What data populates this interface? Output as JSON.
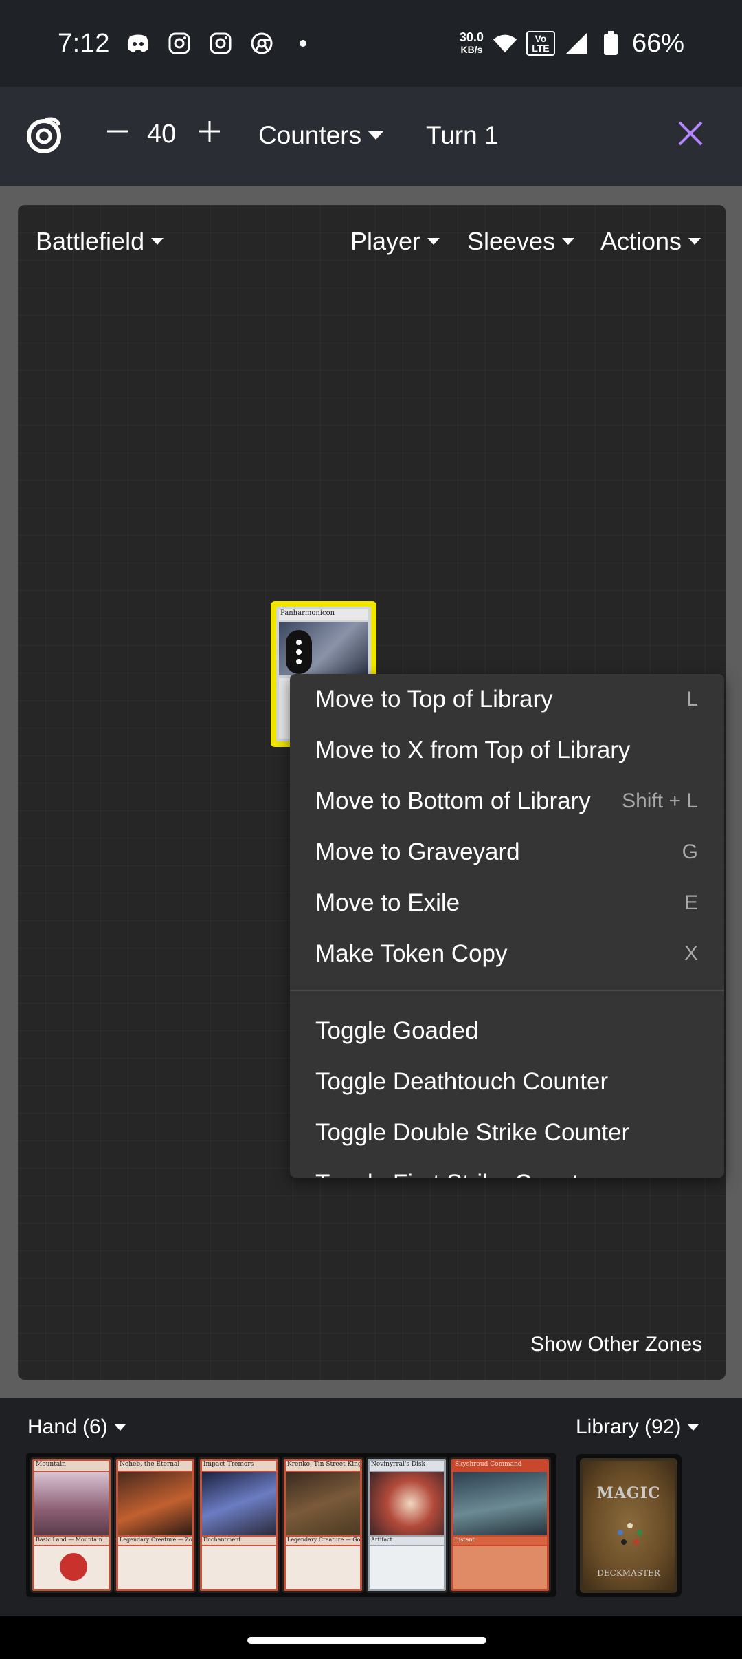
{
  "status_bar": {
    "time": "7:12",
    "speed_value": "30.0",
    "speed_unit": "KB/s",
    "volte": "Vo LTE",
    "battery": "66%",
    "icons": [
      "discord-icon",
      "instagram-icon",
      "instagram-icon",
      "chrome-icon",
      "dot-icon",
      "wifi-icon",
      "signal-icon",
      "battery-icon"
    ]
  },
  "header": {
    "life": "40",
    "counters_label": "Counters",
    "turn_label": "Turn 1",
    "accent_color": "#b388ff"
  },
  "battlefield": {
    "zone_label": "Battlefield",
    "player_label": "Player",
    "sleeves_label": "Sleeves",
    "actions_label": "Actions",
    "show_other_zones": "Show Other Zones",
    "card_name": "Panharmonicon"
  },
  "context_menu": {
    "items": [
      {
        "label": "Move to Top of Library",
        "shortcut": "L"
      },
      {
        "label": "Move to X from Top of Library",
        "shortcut": ""
      },
      {
        "label": "Move to Bottom of Library",
        "shortcut": "Shift + L"
      },
      {
        "label": "Move to Graveyard",
        "shortcut": "G"
      },
      {
        "label": "Move to Exile",
        "shortcut": "E"
      },
      {
        "label": "Make Token Copy",
        "shortcut": "X"
      },
      {
        "label": "Toggle Goaded",
        "shortcut": ""
      },
      {
        "label": "Toggle Deathtouch Counter",
        "shortcut": ""
      },
      {
        "label": "Toggle Double Strike Counter",
        "shortcut": ""
      },
      {
        "label": "Toggle First Strike Counter",
        "shortcut": ""
      }
    ]
  },
  "hand": {
    "label": "Hand (6)",
    "cards": [
      {
        "name": "Mountain",
        "type": "Basic Land — Mountain"
      },
      {
        "name": "Neheb, the Eternal",
        "type": "Legendary Creature — Zombie Minotaur"
      },
      {
        "name": "Impact Tremors",
        "type": "Enchantment"
      },
      {
        "name": "Krenko, Tin Street Kingpin",
        "type": "Legendary Creature — Goblin"
      },
      {
        "name": "Nevinyrral's Disk",
        "type": "Artifact"
      },
      {
        "name": "Skyshroud Command",
        "type": "Instant"
      }
    ]
  },
  "library": {
    "label": "Library (92)",
    "back_logo": "MAGIC",
    "back_footer": "DECKMASTER"
  }
}
